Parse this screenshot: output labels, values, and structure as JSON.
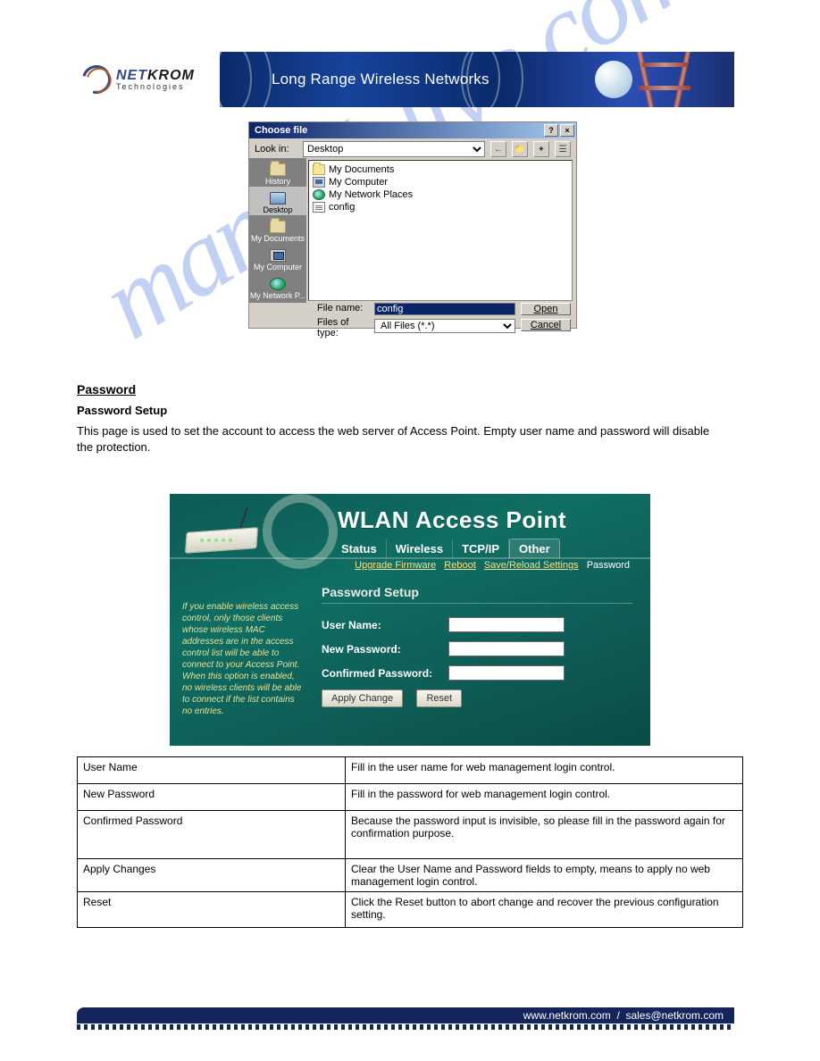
{
  "banner": {
    "logo_main_a": "NET",
    "logo_main_b": "KROM",
    "logo_sub": "Technologies",
    "headline": "Long Range Wireless Networks"
  },
  "dialog": {
    "title": "Choose file",
    "help_btn": "?",
    "close_btn": "×",
    "lookin_label": "Look in:",
    "lookin_value": "Desktop",
    "back_icon": "←",
    "up_icon": "📁",
    "new_icon": "✦",
    "view_icon": "☰",
    "sidebar": [
      {
        "label": "History"
      },
      {
        "label": "Desktop"
      },
      {
        "label": "My Documents"
      },
      {
        "label": "My Computer"
      },
      {
        "label": "My Network P..."
      }
    ],
    "items": [
      {
        "name": "My Documents",
        "kind": "folder"
      },
      {
        "name": "My Computer",
        "kind": "pc"
      },
      {
        "name": "My Network Places",
        "kind": "globe"
      },
      {
        "name": "config",
        "kind": "ini"
      }
    ],
    "filename_label": "File name:",
    "filename_value": "config",
    "filetype_label": "Files of type:",
    "filetype_value": "All Files (*.*)",
    "open_btn": "Open",
    "cancel_btn": "Cancel"
  },
  "section": {
    "heading": "Password",
    "subhead": "Password Setup",
    "desc": "This page is used to set the account to access the web server of Access Point. Empty user name and password will disable the protection."
  },
  "wlan": {
    "title": "WLAN Access Point",
    "tabs": [
      "Status",
      "Wireless",
      "TCP/IP",
      "Other"
    ],
    "subnav": {
      "a": "Upgrade Firmware",
      "b": "Reboot",
      "c": "Save/Reload Settings",
      "d": "Password"
    },
    "panel_title": "Password Setup",
    "user_label": "User Name:",
    "newpw_label": "New Password:",
    "confpw_label": "Confirmed Password:",
    "apply_btn": "Apply Change",
    "reset_btn": "Reset",
    "help_text": "If you enable wireless access control, only those clients whose wireless MAC addresses are in the access control list will be able to connect to your Access Point. When this option is enabled, no wireless clients will be able to connect if the list contains no entries."
  },
  "table": {
    "r1k": "User Name",
    "r1v": "Fill in the user name for web management login control.",
    "r2k": "New Password",
    "r2v": "Fill in the password for web management login control.",
    "r3k": "Confirmed Password",
    "r3v": "Because the password input is invisible, so please fill in the password again for confirmation purpose.",
    "r4k": "Apply Changes",
    "r4v": "Clear the User Name and Password fields to empty, means to apply no web management login control.",
    "r5k": "Reset",
    "r5v": "Click the Reset button to abort change and recover the previous configuration setting."
  },
  "footer": {
    "url": "www.netkrom.com",
    "sep": "/",
    "email": "sales@netkrom.com"
  },
  "watermark": "manualslive.com"
}
